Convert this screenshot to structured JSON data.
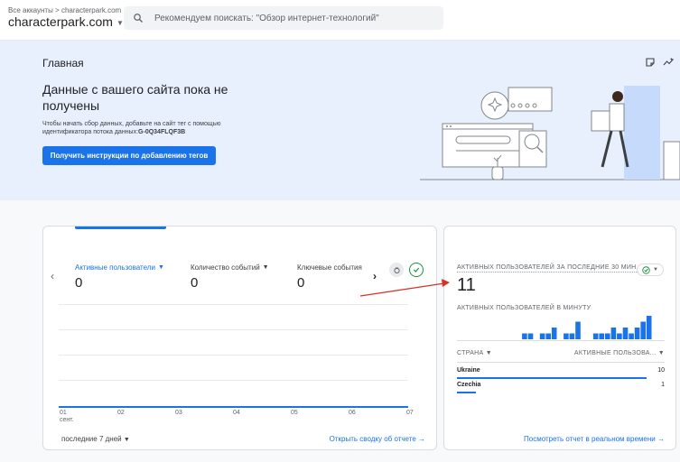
{
  "header": {
    "breadcrumb": "Все аккаунты > characterpark.com",
    "account": "characterpark.com",
    "search_placeholder": "Рекомендуем поискать: \"Обзор интернет-технологий\""
  },
  "hero": {
    "title": "Главная",
    "headline": "Данные с вашего сайта пока не получены",
    "desc_prefix": "Чтобы начать сбор данных, добавьте на сайт тег с помощью идентификатора потока данных:",
    "stream_id": "G-0Q34FLQF3B",
    "button": "Получить инструкции по добавлению тегов"
  },
  "overview": {
    "metrics": [
      {
        "label": "Активные пользователи",
        "value": "0"
      },
      {
        "label": "Количество событий",
        "value": "0"
      },
      {
        "label": "Ключевые события",
        "value": "0"
      }
    ],
    "x_ticks": [
      "01",
      "02",
      "03",
      "04",
      "05",
      "06",
      "07"
    ],
    "x_sub": "сент.",
    "period": "последние 7 дней",
    "link": "Открыть сводку об отчете"
  },
  "realtime": {
    "title": "АКТИВНЫХ ПОЛЬЗОВАТЕЛЕЙ ЗА ПОСЛЕДНИЕ 30 МИН.",
    "value": "11",
    "per_minute_title": "АКТИВНЫХ ПОЛЬЗОВАТЕЛЕЙ В МИНУТУ",
    "per_minute_bars": [
      0,
      0,
      0,
      0,
      0,
      0,
      0,
      0,
      0,
      0,
      1,
      1,
      0,
      1,
      1,
      2,
      0,
      1,
      1,
      3,
      0,
      0,
      1,
      1,
      1,
      2,
      1,
      2,
      1,
      2,
      3,
      4
    ],
    "col_country": "СТРАНА",
    "col_users": "АКТИВНЫЕ ПОЛЬЗОВА...",
    "rows": [
      {
        "country": "Ukraine",
        "users": 10
      },
      {
        "country": "Czechia",
        "users": 1
      }
    ],
    "link": "Посмотреть отчет в реальном времени"
  },
  "colors": {
    "accent": "#1a73e8",
    "hero_bg": "#e8f0fe",
    "annotation": "#d93025"
  }
}
